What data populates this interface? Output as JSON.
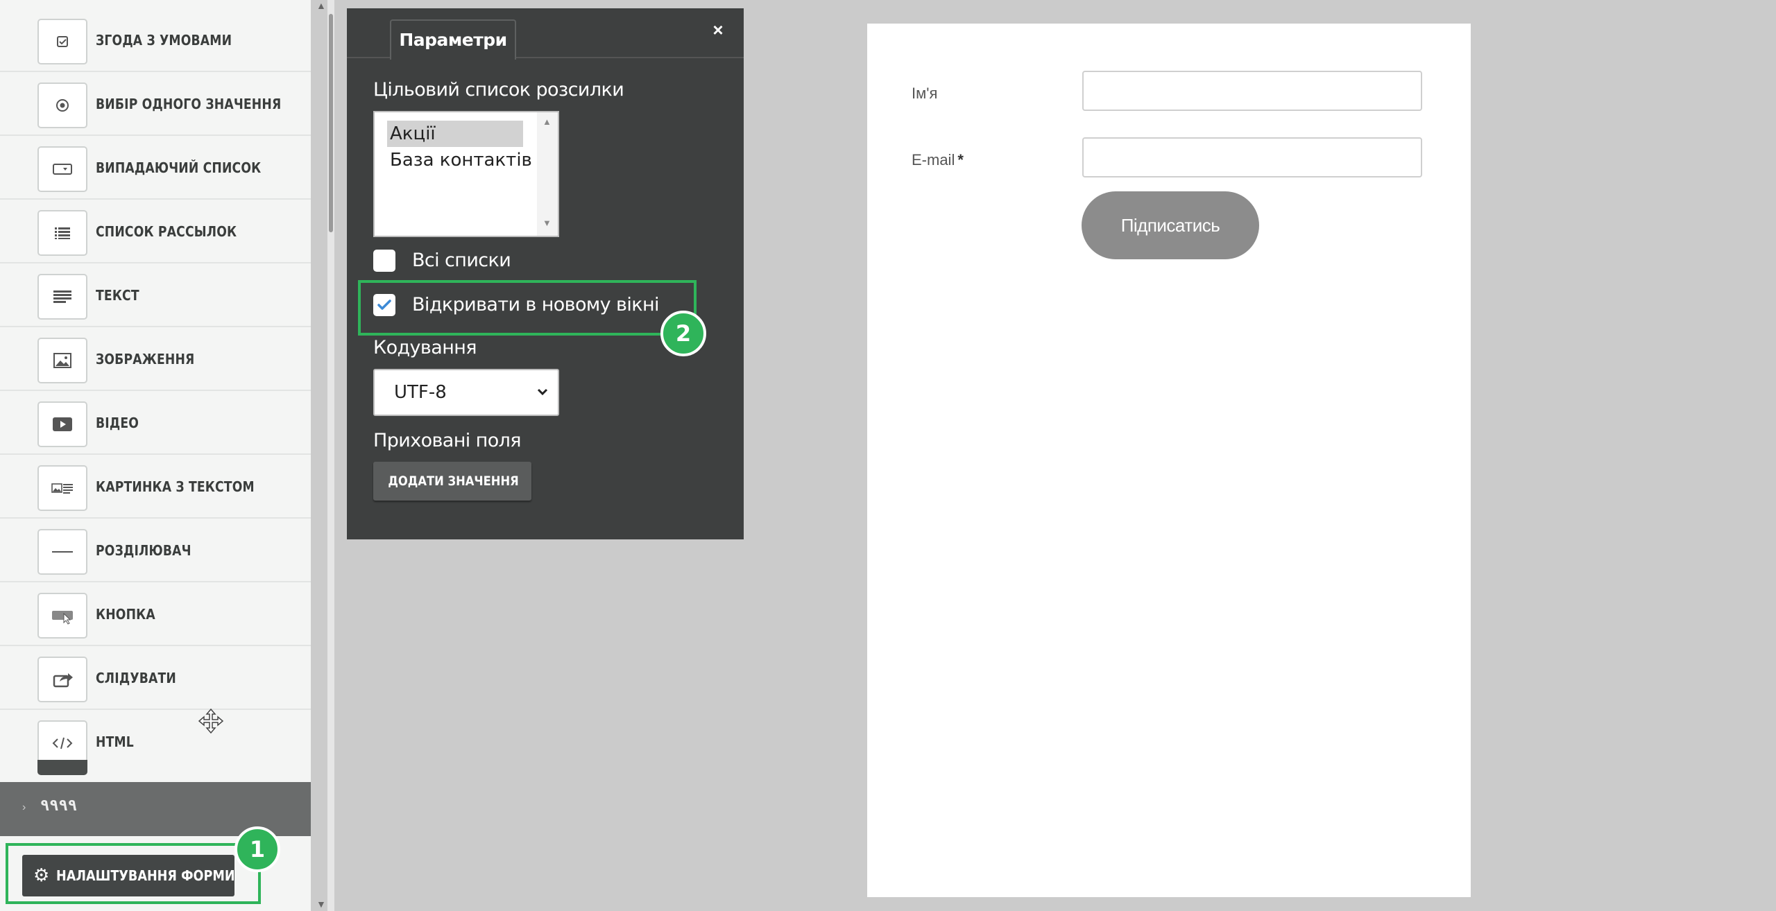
{
  "sidebar": {
    "items": [
      {
        "label": "ЗГОДА З УМОВАМИ",
        "icon": "checkbox-icon"
      },
      {
        "label": "ВИБІР ОДНОГО ЗНАЧЕННЯ",
        "icon": "radio-icon"
      },
      {
        "label": "ВИПАДАЮЧИЙ СПИСОК",
        "icon": "dropdown-icon"
      },
      {
        "label": "СПИСОК РАССЫЛОК",
        "icon": "list-icon"
      },
      {
        "label": "ТЕКСТ",
        "icon": "text-icon"
      },
      {
        "label": "ЗОБРАЖЕННЯ",
        "icon": "image-icon"
      },
      {
        "label": "ВІДЕО",
        "icon": "video-icon"
      },
      {
        "label": "КАРТИНКА З ТЕКСТОМ",
        "icon": "image-text-icon"
      },
      {
        "label": "РОЗДІЛЮВАЧ",
        "icon": "divider-icon"
      },
      {
        "label": "КНОПКА",
        "icon": "button-icon"
      },
      {
        "label": "СЛІДУВАТИ",
        "icon": "share-icon"
      },
      {
        "label": "HTML",
        "icon": "code-icon"
      }
    ],
    "section_label": "٩٩٩٩",
    "settings_button": "НАЛАШТУВАННЯ ФОРМИ",
    "step_badge_1": "1"
  },
  "params": {
    "tab": "Параметри",
    "close": "×",
    "target_list_label": "Цільовий список розсилки",
    "list_options": [
      "Акції",
      "База контактів"
    ],
    "all_lists_label": "Всі списки",
    "new_window_label": "Відкривати в новому вікні",
    "step_badge_2": "2",
    "encoding_label": "Кодування",
    "encoding_value": "UTF-8",
    "hidden_fields_label": "Приховані поля",
    "add_value_button": "ДОДАТИ ЗНАЧЕННЯ"
  },
  "preview": {
    "name_label": "Ім'я",
    "email_label": "E-mail",
    "required_mark": "*",
    "subscribe_button": "Підписатись"
  },
  "colors": {
    "panel_bg": "#3e4040",
    "highlight": "#2fb45a",
    "button_gray": "#8c8c8c"
  }
}
